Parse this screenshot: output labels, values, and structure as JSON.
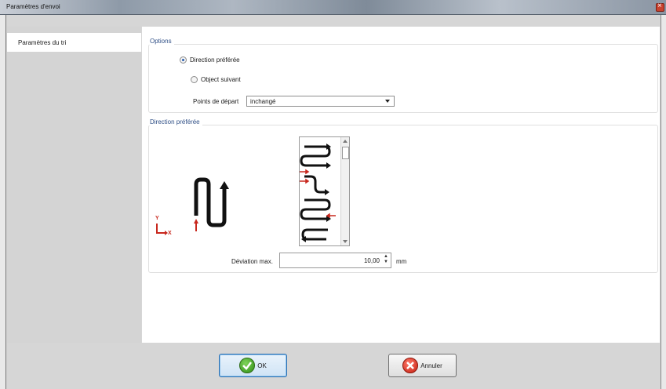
{
  "window": {
    "title": "Paramètres d'envoi"
  },
  "nav": {
    "items": [
      {
        "label": "Paramètres du tri"
      }
    ]
  },
  "options": {
    "group_label": "Options",
    "radio_preferred": "Direction préférée",
    "radio_next": "Object suivant",
    "start_label": "Points de départ",
    "start_value": "inchangé"
  },
  "direction": {
    "group_label": "Direction préférée",
    "axis_y": "Y",
    "axis_x": "X",
    "deviation_label": "Déviation max.",
    "deviation_value": "10,00",
    "deviation_unit": "mm"
  },
  "buttons": {
    "ok": "OK",
    "cancel": "Annuler"
  }
}
